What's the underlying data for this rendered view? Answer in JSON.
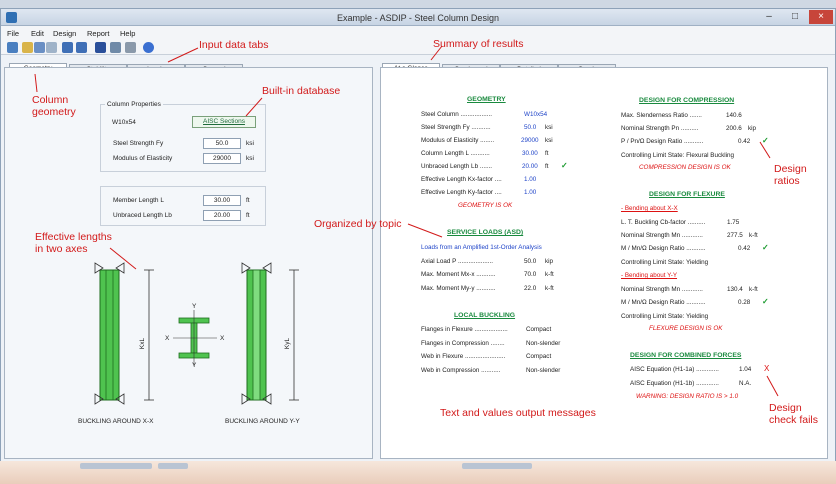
{
  "window": {
    "title": "Example - ASDIP - Steel Column Design"
  },
  "menu": [
    "File",
    "Edit",
    "Design",
    "Report",
    "Help"
  ],
  "left_tabs": [
    "Geometry",
    "Stability",
    "Loads",
    "General"
  ],
  "right_tabs": [
    "At a Glance",
    "Condensed",
    "Detailed",
    "Graph"
  ],
  "geometry": {
    "group_title": "Column Properties",
    "section": "W10x54",
    "aisc_button": "AISC Sections",
    "fy_label": "Steel Strength  Fy",
    "fy_value": "50.0",
    "fy_unit": "ksi",
    "e_label": "Modulus of Elasticity",
    "e_value": "29000",
    "e_unit": "ksi",
    "l_label": "Member Length  L",
    "l_value": "30.00",
    "l_unit": "ft",
    "lb_label": "Unbraced Length  Lb",
    "lb_value": "20.00",
    "lb_unit": "ft",
    "caption_x": "BUCKLING AROUND X-X",
    "caption_y": "BUCKLING AROUND Y-Y",
    "kxl": "KxL",
    "kyl": "KyL",
    "axis_x": "X",
    "axis_y": "Y"
  },
  "results": {
    "geometry": {
      "heading": "GEOMETRY",
      "rows": [
        {
          "label": "Steel Column ..................",
          "value": "W10x54",
          "unit": ""
        },
        {
          "label": "Steel Strength  Fy ...........",
          "value": "50.0",
          "unit": "ksi"
        },
        {
          "label": "Modulus of Elasticity ........",
          "value": "29000",
          "unit": "ksi"
        },
        {
          "label": "Column Length  L ...........",
          "value": "30.00",
          "unit": "ft"
        },
        {
          "label": "Unbraced Length  Lb .......",
          "value": "20.00",
          "unit": "ft"
        },
        {
          "label": "Effective Length Kx-factor ....",
          "value": "1.00",
          "unit": ""
        },
        {
          "label": "Effective Length Ky-factor ....",
          "value": "1.00",
          "unit": ""
        }
      ],
      "status": "GEOMETRY IS OK"
    },
    "service": {
      "heading": "SERVICE LOADS (ASD)",
      "subtitle": "Loads from an Amplified 1st-Order Analysis",
      "rows": [
        {
          "label": "Axial Load  P ....................",
          "value": "50.0",
          "unit": "kip"
        },
        {
          "label": "Max. Moment  Mx-x ...........",
          "value": "70.0",
          "unit": "k-ft"
        },
        {
          "label": "Max. Moment  My-y ...........",
          "value": "22.0",
          "unit": "k-ft"
        }
      ]
    },
    "local": {
      "heading": "LOCAL BUCKLING",
      "rows": [
        {
          "label": "Flanges in Flexure ...................",
          "value": "Compact"
        },
        {
          "label": "Flanges in Compression ........",
          "value": "Non-slender"
        },
        {
          "label": "Web in Flexure .......................",
          "value": "Compact"
        },
        {
          "label": "Web in Compression ...........",
          "value": "Non-slender"
        }
      ]
    },
    "compression": {
      "heading": "DESIGN FOR COMPRESSION",
      "rows": [
        {
          "label": "Max. Slenderness Ratio .......",
          "value": "140.6",
          "unit": ""
        },
        {
          "label": "Nominal Strength  Pn ..........",
          "value": "200.6",
          "unit": "kip"
        },
        {
          "label": "P / Pn/Ω Design Ratio ...........",
          "value": "0.42",
          "unit": ""
        }
      ],
      "limit": "Controlling Limit State: Flexural Buckling",
      "status": "COMPRESSION DESIGN IS OK"
    },
    "flexure": {
      "heading": "DESIGN FOR FLEXURE",
      "bx": "- Bending about X-X",
      "rows_x": [
        {
          "label": "L. T. Buckling  Cb-factor ..........",
          "value": "1.75",
          "unit": ""
        },
        {
          "label": "Nominal Strength  Mn ............",
          "value": "277.5",
          "unit": "k-ft"
        },
        {
          "label": "M / Mn/Ω Design Ratio ...........",
          "value": "0.42",
          "unit": ""
        }
      ],
      "limit_x": "Controlling Limit State: Yielding",
      "by": "- Bending about Y-Y",
      "rows_y": [
        {
          "label": "Nominal Strength  Mn ............",
          "value": "130.4",
          "unit": "k-ft"
        },
        {
          "label": "M / Mn/Ω Design Ratio ...........",
          "value": "0.28",
          "unit": ""
        }
      ],
      "limit_y": "Controlling Limit State: Yielding",
      "status": "FLEXURE DESIGN IS OK"
    },
    "combined": {
      "heading": "DESIGN FOR COMBINED FORCES",
      "rows": [
        {
          "label": "AISC Equation (H1-1a) .............",
          "value": "1.04"
        },
        {
          "label": "AISC Equation (H1-1b) .............",
          "value": "N.A."
        }
      ],
      "warning": "WARNING: DESIGN RATIO IS > 1.0"
    }
  },
  "annotations": {
    "input_tabs": "Input data tabs",
    "summary": "Summary of results",
    "column_geometry_1": "Column",
    "column_geometry_2": "geometry",
    "database": "Built-in database",
    "effective_1": "Effective lengths",
    "effective_2": "in two axes",
    "organized": "Organized by topic",
    "design_ratios_1": "Design",
    "design_ratios_2": "ratios",
    "text_values": "Text and values output messages",
    "design_check_1": "Design",
    "design_check_2": "check fails"
  },
  "colors": {
    "accent_green": "#198a3e",
    "value_blue": "#1f44c8",
    "warning_red": "#d11",
    "annotation_red": "#d21a1a",
    "column_green": "#4fc34f"
  }
}
